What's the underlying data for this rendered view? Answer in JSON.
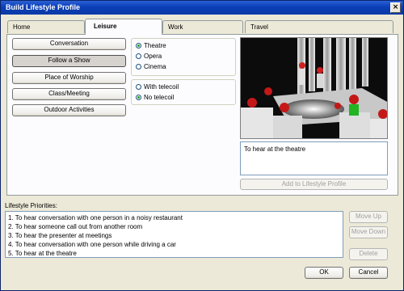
{
  "window": {
    "title": "Build Lifestyle Profile",
    "close_glyph": "×"
  },
  "tabs": [
    {
      "label": "Home",
      "active": false
    },
    {
      "label": "Leisure",
      "active": true
    },
    {
      "label": "Work",
      "active": false
    },
    {
      "label": "Travel",
      "active": false
    }
  ],
  "leisure": {
    "activities": [
      {
        "label": "Conversation",
        "pressed": false
      },
      {
        "label": "Follow a Show",
        "pressed": true
      },
      {
        "label": "Place of Worship",
        "pressed": false
      },
      {
        "label": "Class/Meeting",
        "pressed": false
      },
      {
        "label": "Outdoor Activities",
        "pressed": false
      }
    ],
    "venue_options": [
      {
        "label": "Theatre",
        "selected": true
      },
      {
        "label": "Opera",
        "selected": false
      },
      {
        "label": "Cinema",
        "selected": false
      }
    ],
    "telecoil_options": [
      {
        "label": "With telecoil",
        "selected": false
      },
      {
        "label": "No telecoil",
        "selected": true
      }
    ],
    "scene_description": "To hear at the theatre",
    "add_button": "Add to Lifestyle Profile"
  },
  "priorities": {
    "label": "Lifestyle Priorities:",
    "items": [
      "1. To hear conversation with one person in a noisy restaurant",
      "2. To hear someone call out from another room",
      "3. To hear the presenter at meetings",
      "4. To hear conversation with one person while driving a car",
      "5. To hear at the theatre"
    ],
    "move_up": "Move Up",
    "move_down": "Move Down",
    "delete": "Delete"
  },
  "footer": {
    "ok": "OK",
    "cancel": "Cancel"
  }
}
